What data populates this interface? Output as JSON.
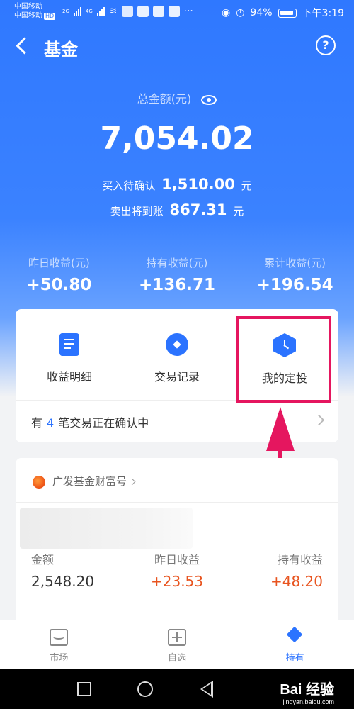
{
  "statusbar": {
    "carrier1": "中国移动",
    "carrier2": "中国移动",
    "hd": "HD",
    "net1": "2G",
    "net2": "4G",
    "battery": "94%",
    "time": "下午3:19"
  },
  "header": {
    "title": "基金",
    "help": "?"
  },
  "summary": {
    "total_label": "总金额(元)",
    "total_value": "7,054.02",
    "buy_pending_label": "买入待确认",
    "buy_pending_value": "1,510.00",
    "sell_pending_label": "卖出将到账",
    "sell_pending_value": "867.31",
    "unit": "元"
  },
  "stats": [
    {
      "label": "昨日收益(元)",
      "value": "+50.80"
    },
    {
      "label": "持有收益(元)",
      "value": "+136.71"
    },
    {
      "label": "累计收益(元)",
      "value": "+196.54"
    }
  ],
  "actions": [
    {
      "label": "收益明细",
      "icon": "document-icon"
    },
    {
      "label": "交易记录",
      "icon": "trade-record-icon"
    },
    {
      "label": "我的定投",
      "icon": "clock-hexagon-icon"
    }
  ],
  "confirm": {
    "prefix": "有",
    "count": "4",
    "suffix": "笔交易正在确认中"
  },
  "fund": {
    "provider": "广发基金财富号",
    "columns": [
      {
        "label": "金额",
        "value": "2,548.20"
      },
      {
        "label": "昨日收益",
        "value": "+23.53"
      },
      {
        "label": "持有收益",
        "value": "+48.20"
      }
    ]
  },
  "tabs": [
    {
      "label": "市场"
    },
    {
      "label": "自选"
    },
    {
      "label": "持有"
    }
  ],
  "watermark": {
    "brand": "Bai 经验",
    "url": "jingyan.baidu.com"
  },
  "colors": {
    "primary": "#2b73ff",
    "highlight": "#e5165f",
    "gain": "#e8541f"
  }
}
